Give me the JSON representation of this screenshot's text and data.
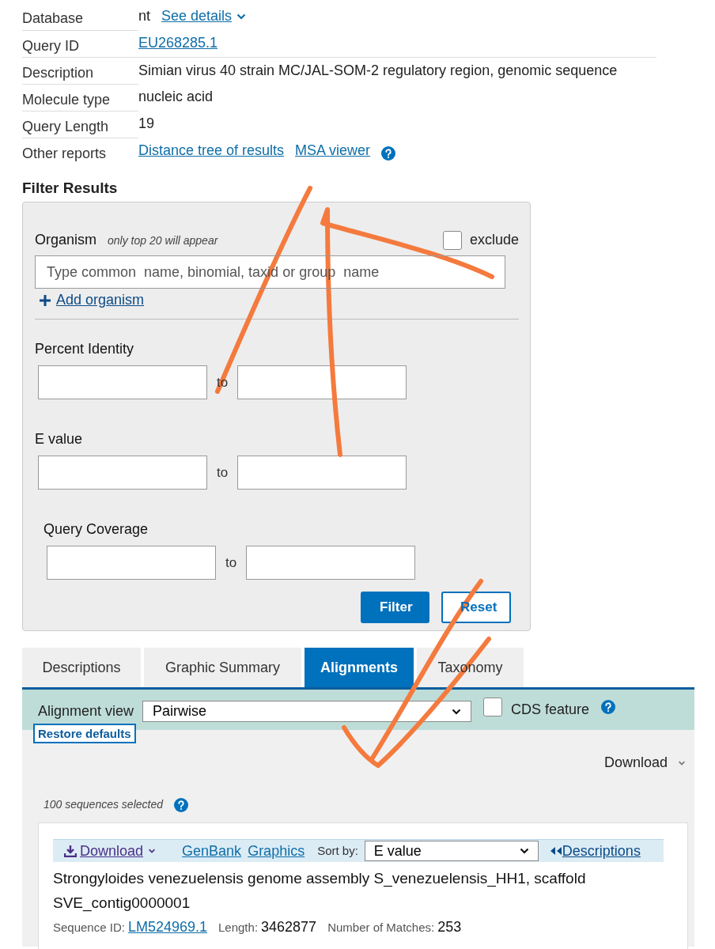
{
  "summary": {
    "rows": [
      {
        "label": "Database",
        "values": [
          {
            "text": "nt",
            "link": false,
            "caret": false
          },
          {
            "text": "See details",
            "link": true,
            "caret": true
          }
        ],
        "help": false
      },
      {
        "label": "Query ID",
        "values": [
          {
            "text": "EU268285.1",
            "link": true,
            "caret": false
          }
        ],
        "help": false
      },
      {
        "label": "Description",
        "values": [
          {
            "text": "Simian virus 40 strain MC/JAL-SOM-2 regulatory region, genomic sequence",
            "link": false,
            "caret": false
          }
        ],
        "help": false
      },
      {
        "label": "Molecule type",
        "values": [
          {
            "text": "nucleic acid",
            "link": false,
            "caret": false
          }
        ],
        "help": false
      },
      {
        "label": "Query Length",
        "values": [
          {
            "text": "19",
            "link": false,
            "caret": false
          }
        ],
        "help": false
      },
      {
        "label": "Other reports",
        "values": [
          {
            "text": "Distance tree of results",
            "link": true,
            "caret": false
          },
          {
            "text": "MSA viewer",
            "link": true,
            "caret": false
          }
        ],
        "help": true
      }
    ]
  },
  "filter": {
    "title": "Filter Results",
    "organism": {
      "label": "Organism",
      "note": "only top 20 will appear",
      "placeholder": "Type common  name, binomial, taxid or group  name",
      "add_label": "Add organism",
      "exclude": {
        "label": "exclude",
        "checked": false
      }
    },
    "ranges": [
      {
        "label": "Percent Identity",
        "to": "to"
      },
      {
        "label": "E value",
        "to": "to"
      },
      {
        "label": "Query Coverage",
        "to": "to"
      }
    ],
    "buttons": [
      {
        "label": "Filter",
        "kind": "primary"
      },
      {
        "label": "Reset",
        "kind": "secondary"
      }
    ]
  },
  "tabs": [
    {
      "label": "Descriptions",
      "selected": false
    },
    {
      "label": "Graphic Summary",
      "selected": false
    },
    {
      "label": "Alignments",
      "selected": true
    },
    {
      "label": "Taxonomy",
      "selected": false
    }
  ],
  "alignment_bar": {
    "label": "Alignment view",
    "value": "Pairwise",
    "cds": {
      "label": "CDS feature",
      "checked": false
    },
    "restore": "Restore defaults"
  },
  "download": "Download",
  "selected_count": "100 sequences selected",
  "result": {
    "toolbar": {
      "download": "Download",
      "links": [
        "GenBank",
        "Graphics"
      ],
      "sort_label": "Sort by:",
      "sort_value": "E value",
      "descriptions": "Descriptions"
    },
    "title": "Strongyloides venezuelensis genome assembly S_venezuelensis_HH1, scaffold SVE_contig0000001",
    "meta": [
      {
        "label": "Sequence ID:",
        "value": "LM524969.1",
        "link": true
      },
      {
        "label": "Length:",
        "value": "3462877",
        "link": false
      },
      {
        "label": "Number of Matches:",
        "value": "253",
        "link": false
      }
    ]
  }
}
